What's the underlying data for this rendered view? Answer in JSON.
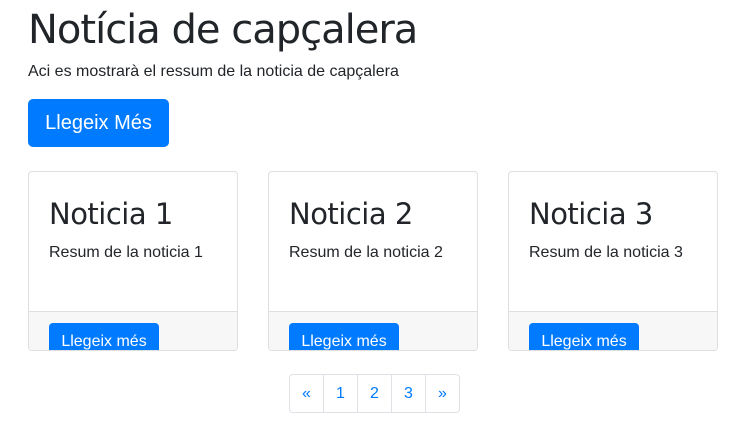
{
  "hero": {
    "title": "Notícia de capçalera",
    "summary": "Aci es mostrarà el ressum de la noticia de capçalera",
    "button": "Llegeix Més"
  },
  "cards": [
    {
      "title": "Noticia 1",
      "text": "Resum de la noticia 1",
      "button": "Llegeix més"
    },
    {
      "title": "Noticia 2",
      "text": "Resum de la noticia 2",
      "button": "Llegeix més"
    },
    {
      "title": "Noticia 3",
      "text": "Resum de la noticia 3",
      "button": "Llegeix més"
    }
  ],
  "pagination": {
    "prev": "«",
    "pages": [
      "1",
      "2",
      "3"
    ],
    "next": "»"
  },
  "colors": {
    "primary": "#007bff",
    "text": "#212529"
  }
}
